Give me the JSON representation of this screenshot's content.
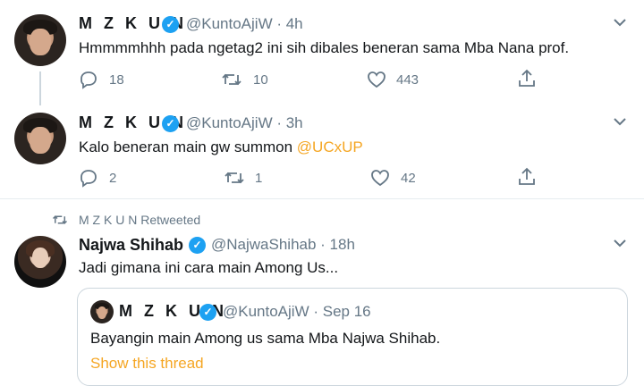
{
  "tweets": [
    {
      "display_name": "M Z K U N",
      "handle_time": "@KuntoAjiW · 4h",
      "text": "Hmmmmhhh pada ngetag2 ini sih dibales beneran sama Mba Nana prof.",
      "replies": "18",
      "retweets": "10",
      "likes": "443"
    },
    {
      "display_name": "M Z K U N",
      "handle_time": "@KuntoAjiW · 3h",
      "text_prefix": "Kalo beneran main gw summon ",
      "mention": "@UCxUP",
      "replies": "2",
      "retweets": "1",
      "likes": "42"
    }
  ],
  "retweet": {
    "banner": "M Z K U N Retweeted",
    "display_name": "Najwa Shihab",
    "handle_time": "@NajwaShihab · 18h",
    "text": "Jadi gimana ini cara main Among Us...",
    "quote": {
      "display_name": "M Z K U N",
      "handle_time": "@KuntoAjiW · Sep 16",
      "text": "Bayangin main Among us sama Mba Najwa Shihab.",
      "show_thread": "Show this thread"
    }
  },
  "colors": {
    "verified": "#1da1f2",
    "secondary_text": "#657786",
    "link": "#f5a623"
  },
  "icons": [
    "reply-icon",
    "retweet-icon",
    "like-icon",
    "share-icon",
    "chevron-down-icon",
    "verified-badge-icon"
  ]
}
